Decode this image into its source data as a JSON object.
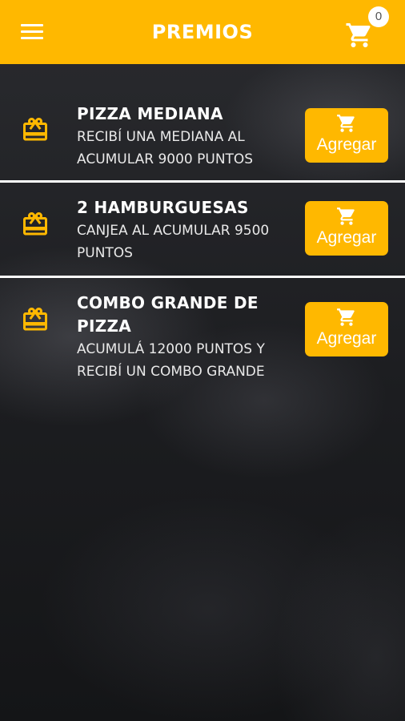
{
  "header": {
    "title": "PREMIOS",
    "cart_count": "0",
    "accent_color": "#ffb800"
  },
  "icons": {
    "menu": "hamburger-menu-icon",
    "cart": "shopping-cart-icon",
    "reward": "gift-card-icon"
  },
  "rewards": [
    {
      "name": "PIZZA MEDIANA",
      "description": "RECIBÍ UNA MEDIANA AL ACUMULAR 9000 PUNTOS",
      "button_label": "Agregar"
    },
    {
      "name": "2 HAMBURGUESAS",
      "description": "CANJEA AL ACUMULAR  9500 PUNTOS",
      "button_label": "Agregar"
    },
    {
      "name": "COMBO GRANDE DE PIZZA",
      "description": "ACUMULÁ 12000 PUNTOS Y RECIBÍ UN COMBO GRANDE",
      "button_label": "Agregar"
    }
  ]
}
